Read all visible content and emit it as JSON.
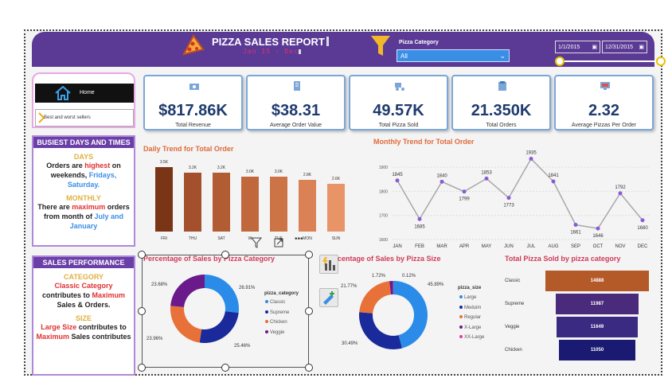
{
  "header": {
    "title": "PIZZA SALES REPORT",
    "subtitle": "Jan 15 - Dec",
    "category_label": "Pizza Category",
    "category_value": "All",
    "date_start": "1/1/2015",
    "date_end": "12/31/2015"
  },
  "nav": {
    "home": "Home",
    "best_worst": "Best and worst sellers"
  },
  "busiest": {
    "head": "BUSIEST DAYS  AND TIMES",
    "days_sub": "DAYS",
    "days_t1": "Orders are ",
    "days_hl1": "highest",
    "days_t2": " on weekends, ",
    "days_hl2": "Fridays, Saturday.",
    "monthly_sub": "MONTHLY",
    "m_t1": "There are ",
    "m_hl1": "maximum",
    "m_t2": " orders from month of ",
    "m_hl2": "July and January"
  },
  "performance": {
    "head": "SALES PERFORMANCE",
    "cat_sub": "CATEGORY",
    "c_hl1": "Classic Category",
    "c_t1": " contributes to ",
    "c_hl2": "Maximum",
    "c_t2": " Sales & Orders.",
    "size_sub": "SIZE",
    "s_hl1": "Large Size",
    "s_t1": " contributes to ",
    "s_hl2": "Maximum",
    "s_t2": " Sales contributes"
  },
  "kpis": [
    {
      "value": "$817.86K",
      "label": "Total Revenue",
      "icon": "money-icon"
    },
    {
      "value": "$38.31",
      "label": "Average Order Value",
      "icon": "receipt-icon"
    },
    {
      "value": "49.57K",
      "label": "Total Pizza Sold",
      "icon": "delivery-icon"
    },
    {
      "value": "21.350K",
      "label": "Total Orders",
      "icon": "order-icon"
    },
    {
      "value": "2.32",
      "label": "Average Pizzas Per Order",
      "icon": "monitor-icon"
    }
  ],
  "chart_data": [
    {
      "type": "bar",
      "title": "Daily Trend for Total Order",
      "categories": [
        "FRI",
        "THU",
        "SAT",
        "W",
        "TUE",
        "MON",
        "SUN"
      ],
      "values": [
        3.5,
        3.2,
        3.2,
        3.0,
        3.0,
        2.8,
        2.6
      ],
      "labels": [
        "3.5K",
        "3.2K",
        "3.2K",
        "3.0K",
        "3.0K",
        "2.8K",
        "2.6K"
      ],
      "colors": [
        "#7a3416",
        "#a4502c",
        "#b25c33",
        "#c0683c",
        "#cd7446",
        "#db8156",
        "#e89466"
      ]
    },
    {
      "type": "line",
      "title": "Monthly Trend for Total Order",
      "categories": [
        "JAN",
        "FEB",
        "MAR",
        "APR",
        "MAY",
        "JUN",
        "JUL",
        "AUG",
        "SEP",
        "OCT",
        "NOV",
        "DEC"
      ],
      "values": [
        1845,
        1685,
        1840,
        1799,
        1853,
        1773,
        1935,
        1841,
        1661,
        1646,
        1792,
        1680
      ],
      "yticks": [
        "1900",
        "1800",
        "1700",
        "1600"
      ],
      "ylim": [
        1600,
        1950
      ],
      "color": "#a8a8a8"
    },
    {
      "type": "pie",
      "title": "Percentage of Sales by Pizza Category",
      "legend_title": "pizza_category",
      "labels": [
        "Classic",
        "Supreme",
        "Chicken",
        "Veggie"
      ],
      "values": [
        26.91,
        25.46,
        23.96,
        23.68
      ],
      "value_labels": [
        "26.91%",
        "25.46%",
        "23.96%",
        "23.68%"
      ],
      "colors": [
        "#2a8ce8",
        "#1a2a9a",
        "#e8713a",
        "#6a1a8a"
      ]
    },
    {
      "type": "pie",
      "title": "centage of Sales by Pizza Size",
      "legend_title": "pizza_size",
      "labels": [
        "Large",
        "Meduim",
        "Regular",
        "X-Large",
        "XX-Large"
      ],
      "values": [
        45.89,
        30.49,
        21.77,
        1.72,
        0.12
      ],
      "value_labels": [
        "45.89%",
        "30.49%",
        "21.77%",
        "1.72%",
        "0.12%"
      ],
      "colors": [
        "#2a8ce8",
        "#1a2a9a",
        "#e8713a",
        "#6a1a8a",
        "#e83a9a"
      ]
    },
    {
      "type": "bar",
      "title": "Total Pizza Sold by pizza category",
      "categories": [
        "Classic",
        "Supreme",
        "Veggie",
        "Chicken"
      ],
      "values": [
        14888,
        11987,
        11649,
        11050
      ],
      "labels": [
        "14888",
        "11987",
        "11649",
        "11050"
      ],
      "colors": [
        "#b45a28",
        "#4a2a7a",
        "#3a2a82",
        "#1a1a72"
      ]
    }
  ]
}
